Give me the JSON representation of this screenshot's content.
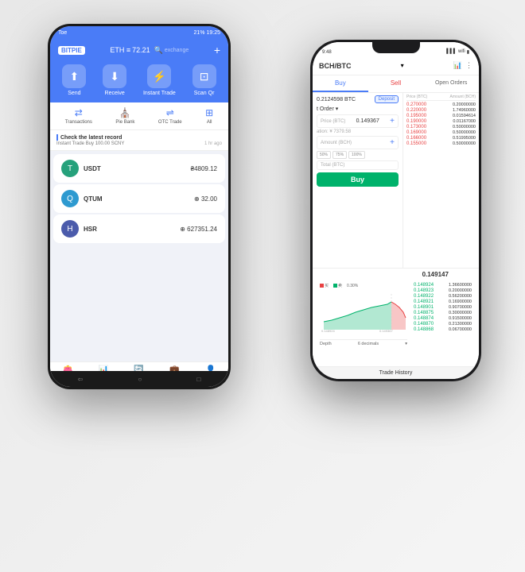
{
  "scene": {
    "background": "#f0f0f0"
  },
  "android": {
    "status_bar": {
      "time": "19:25",
      "battery": "21%"
    },
    "header": {
      "logo": "BITPIE",
      "currency": "ETH",
      "balance": "72.21",
      "search_placeholder": "exchange"
    },
    "action_buttons": [
      {
        "icon": "↑",
        "label": "Send"
      },
      {
        "icon": "↓",
        "label": "Receive"
      },
      {
        "icon": "⚡",
        "label": "Instant Trade"
      },
      {
        "icon": "⊡",
        "label": "Scan Qr"
      }
    ],
    "secondary_buttons": [
      {
        "icon": "⇄",
        "label": "Transactions"
      },
      {
        "icon": "⛪",
        "label": "Pie Bank"
      },
      {
        "icon": "⇌",
        "label": "OTC Trade"
      },
      {
        "icon": "⊞",
        "label": "All"
      }
    ],
    "notification": {
      "title": "Check the latest record",
      "text": "Instant Trade Buy 100.00 SCNY",
      "time": "1 hr ago"
    },
    "coins": [
      {
        "name": "USDT",
        "balance": "₴4809.12",
        "icon": "T",
        "color": "#26a17b"
      },
      {
        "name": "QTUM",
        "balance": "⊕ 32.00",
        "icon": "Q",
        "color": "#2e9ad0"
      },
      {
        "name": "HSR",
        "balance": "⊕ 627351.24",
        "icon": "H",
        "color": "#4b5bab"
      }
    ],
    "bottom_nav": [
      {
        "icon": "👛",
        "label": "Wallet",
        "active": true
      },
      {
        "icon": "📊",
        "label": "Ex.",
        "active": false
      },
      {
        "icon": "🔄",
        "label": "Dis-",
        "active": false
      },
      {
        "icon": "💼",
        "label": "Assets",
        "active": false
      },
      {
        "icon": "👤",
        "label": "Me",
        "active": false
      }
    ]
  },
  "iphone": {
    "status_bar": {
      "time": "9:48",
      "signal": "●●●●",
      "battery": "🔋"
    },
    "header": {
      "pair": "BCH/BTC",
      "dropdown_icon": "▾"
    },
    "tabs": [
      "Buy",
      "Sell",
      "Open Orders"
    ],
    "order_form": {
      "btc_balance": "0.2124598 BTC",
      "deposit_label": "Deposit",
      "order_type": "t Order",
      "price_label": "Price (BTC)",
      "price_value": "0.149367",
      "estimation_label": "ation: ¥ 7379.58",
      "amount_label": "Amount (BCH)",
      "pct_btns": [
        "50%",
        "75%",
        "100%"
      ],
      "total_label": "Total (BTC)",
      "buy_btn": "Buy"
    },
    "order_book": {
      "headers": [
        "Price (BTC)",
        "Amount (BCH)"
      ],
      "sell_orders": [
        {
          "price": "0.270000",
          "amount": "0.20000000",
          "color": "red"
        },
        {
          "price": "0.220000",
          "amount": "1.74960000",
          "color": "red"
        },
        {
          "price": "0.195000",
          "amount": "0.01594614",
          "color": "red"
        },
        {
          "price": "0.190000",
          "amount": "0.01167000",
          "color": "red"
        },
        {
          "price": "0.173000",
          "amount": "0.50000000",
          "color": "red"
        },
        {
          "price": "0.169000",
          "amount": "0.50000000",
          "color": "red"
        },
        {
          "price": "0.166000",
          "amount": "0.51995000",
          "color": "red"
        },
        {
          "price": "0.155000",
          "amount": "0.50000000",
          "color": "red"
        }
      ],
      "mid_price": "0.149147",
      "buy_orders": [
        {
          "price": "0.148924",
          "amount": "1.36600000",
          "color": "green"
        },
        {
          "price": "0.148923",
          "amount": "0.20000000",
          "color": "green"
        },
        {
          "price": "0.148922",
          "amount": "0.56200000",
          "color": "green"
        },
        {
          "price": "0.148921",
          "amount": "0.16900000",
          "color": "green"
        },
        {
          "price": "0.148901",
          "amount": "0.90700000",
          "color": "green"
        },
        {
          "price": "0.148875",
          "amount": "0.30000000",
          "color": "green"
        },
        {
          "price": "0.148874",
          "amount": "0.91500000",
          "color": "green"
        },
        {
          "price": "0.148870",
          "amount": "0.21300000",
          "color": "green"
        },
        {
          "price": "0.148868",
          "amount": "0.06700000",
          "color": "green"
        }
      ]
    },
    "chart": {
      "legend_buy": "买",
      "legend_sell": "卖",
      "pct": "0.30%",
      "depth_label": "Depth",
      "decimals": "6 decimals"
    },
    "trade_history": "Trade History"
  }
}
